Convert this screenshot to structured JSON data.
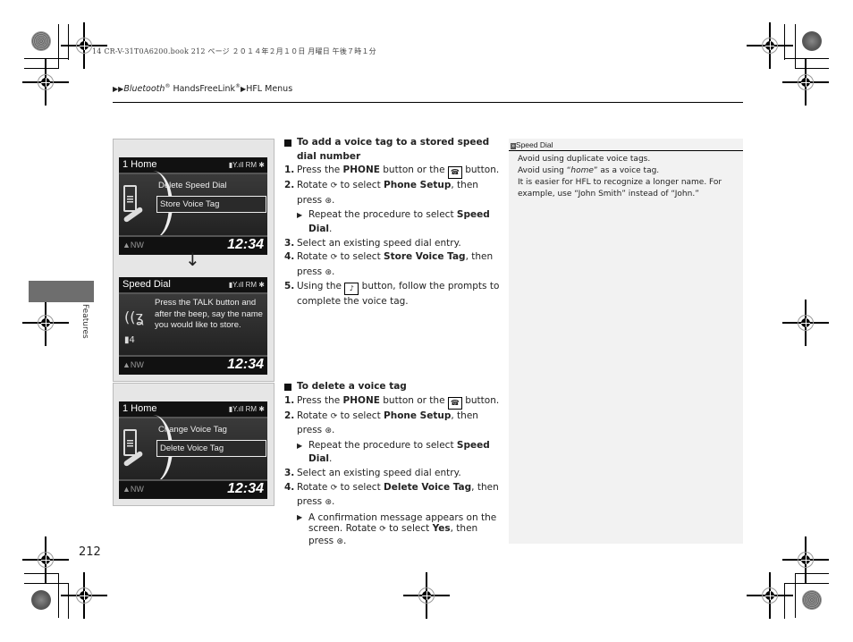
{
  "header_meta": "14 CR-V-31T0A6200.book  212 ページ  ２０１４年２月１０日  月曜日  午後７時１分",
  "breadcrumb": {
    "arrows": "▶▶",
    "part1": "Bluetooth",
    "reg1": "®",
    "part2": " HandsFreeLink",
    "reg2": "®",
    "sep": "▶",
    "part3": "HFL Menus"
  },
  "side_tab_label": "Features",
  "page_number": "212",
  "screens": [
    {
      "title": "1 Home",
      "status": "▮Y.ıll RM ✱",
      "items": [
        "Delete Speed Dial",
        "Store Voice Tag"
      ],
      "selected_index": 1,
      "compass": "▲NW",
      "time": "12:34"
    },
    {
      "title": "Speed Dial",
      "status": "▮Y.ıll RM ✱",
      "message": "Press the TALK button and after the beep, say the name you would like to store.",
      "slot": "4",
      "compass": "▲NW",
      "time": "12:34"
    },
    {
      "title": "1 Home",
      "status": "▮Y.ıll RM ✱",
      "items": [
        "Change Voice Tag",
        "Delete Voice Tag"
      ],
      "selected_index": 1,
      "compass": "▲NW",
      "time": "12:34"
    }
  ],
  "section_add": {
    "title": "To add a voice tag to a stored speed dial number",
    "steps": [
      {
        "num": "1.",
        "pre": "Press the ",
        "bold": "PHONE",
        "post": " button or the",
        "post2": " button."
      },
      {
        "num": "2.",
        "pre": "Rotate ",
        "mid": " to select ",
        "bold": "Phone Setup",
        "post": ", then press "
      },
      {
        "sub": true,
        "pre": "Repeat the procedure to select ",
        "bold": "Speed Dial",
        "post": "."
      },
      {
        "num": "3.",
        "text": "Select an existing speed dial entry."
      },
      {
        "num": "4.",
        "pre": "Rotate ",
        "mid": " to select ",
        "bold": "Store Voice Tag",
        "post": ", then press "
      },
      {
        "num": "5.",
        "pre": "Using the ",
        "post": " button, follow the prompts to complete the voice tag."
      }
    ]
  },
  "section_delete": {
    "title": "To delete a voice tag",
    "steps": [
      {
        "num": "1.",
        "pre": "Press the ",
        "bold": "PHONE",
        "post": " button or the",
        "post2": " button."
      },
      {
        "num": "2.",
        "pre": "Rotate ",
        "mid": " to select ",
        "bold": "Phone Setup",
        "post": ", then press "
      },
      {
        "sub": true,
        "pre": "Repeat the procedure to select ",
        "bold": "Speed Dial",
        "post": "."
      },
      {
        "num": "3.",
        "text": "Select an existing speed dial entry."
      },
      {
        "num": "4.",
        "pre": "Rotate ",
        "mid": " to select ",
        "bold": "Delete Voice Tag",
        "post": ", then press "
      },
      {
        "sub": true,
        "pre": "A confirmation message appears on the screen. Rotate ",
        "mid": " to select ",
        "bold": "Yes",
        "post": ", then press "
      }
    ]
  },
  "note": {
    "icon": "»",
    "title": "Speed Dial",
    "lines": [
      "Avoid using duplicate voice tags.",
      "Avoid using “",
      "home",
      "” as a voice tag.",
      "It is easier for HFL to recognize a longer name. For example, use “John Smith” instead of “John.”"
    ]
  },
  "icons": {
    "phone_button": "☎",
    "talk_button": "♪",
    "knob_rotate": "⟳",
    "knob_press": "⊛",
    "triangle": "▶",
    "down_arrow": "↓"
  }
}
